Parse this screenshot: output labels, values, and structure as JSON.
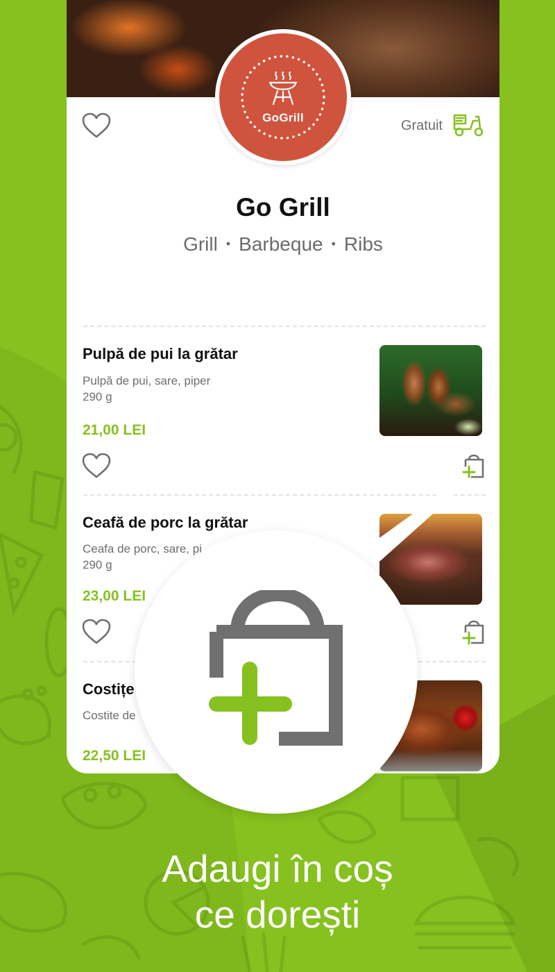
{
  "restaurant": {
    "name": "Go Grill",
    "logo_text": "GoGrill",
    "tags": [
      "Grill",
      "Barbeque",
      "Ribs"
    ],
    "delivery_label": "Gratuit"
  },
  "menu_items": [
    {
      "name": "Pulpă de pui la grătar",
      "ingredients": "Pulpă de pui, sare, piper",
      "weight": "290 g",
      "price": "21,00 LEI"
    },
    {
      "name": "Ceafă de porc la grătar",
      "ingredients": "Ceafa de porc, sare, pi",
      "weight": "290 g",
      "price": "23,00 LEI"
    },
    {
      "name": "Costițe",
      "ingredients": "Costite de",
      "price": "22,50 LEI"
    }
  ],
  "caption": {
    "line1": "Adaugi în coș",
    "line2": "ce dorești"
  },
  "colors": {
    "brand_green": "#86c11f",
    "logo_red": "#d0533e",
    "icon_gray": "#707070"
  },
  "icons": {
    "favorite": "heart-outline-icon",
    "add_to_cart": "shopping-bag-plus-icon",
    "delivery": "scooter-icon",
    "logo": "grill-icon"
  }
}
